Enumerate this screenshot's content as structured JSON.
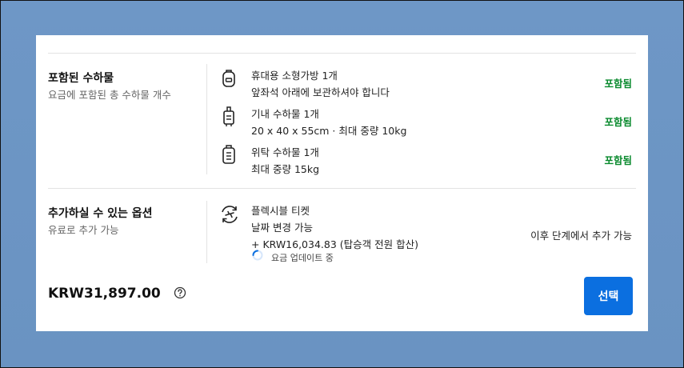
{
  "sections": [
    {
      "title": "포함된 수하물",
      "subtitle": "요금에 포함된 총 수하물 개수",
      "items": [
        {
          "icon": "backpack-icon",
          "title": "휴대용 소형가방 1개",
          "detail": "앞좌석 아래에 보관하셔야 합니다",
          "status": "포함됨"
        },
        {
          "icon": "cabin-bag-icon",
          "title": "기내 수하물 1개",
          "detail": "20 x 40 x 55cm · 최대 중량 10kg",
          "status": "포함됨"
        },
        {
          "icon": "checked-bag-icon",
          "title": "위탁 수하물 1개",
          "detail": "최대 중량 15kg",
          "status": "포함됨"
        }
      ]
    },
    {
      "title": "추가하실 수 있는 옵션",
      "subtitle": "유료로 추가 가능",
      "options": [
        {
          "icon": "flexible-ticket-icon",
          "title": "플렉시블 티켓",
          "line1": "날짜 변경 가능",
          "line2": "+ KRW16,034.83 (탑승객 전원 합산)",
          "status": "이후 단계에서 추가 가능",
          "updating": "요금 업데이트 중"
        }
      ]
    }
  ],
  "footer": {
    "price": "KRW31,897.00",
    "help_icon": "question-circle-icon",
    "select_label": "선택"
  },
  "colors": {
    "included": "#0a8a2e",
    "button": "#0b6fe0",
    "background": "#6e97c6"
  }
}
